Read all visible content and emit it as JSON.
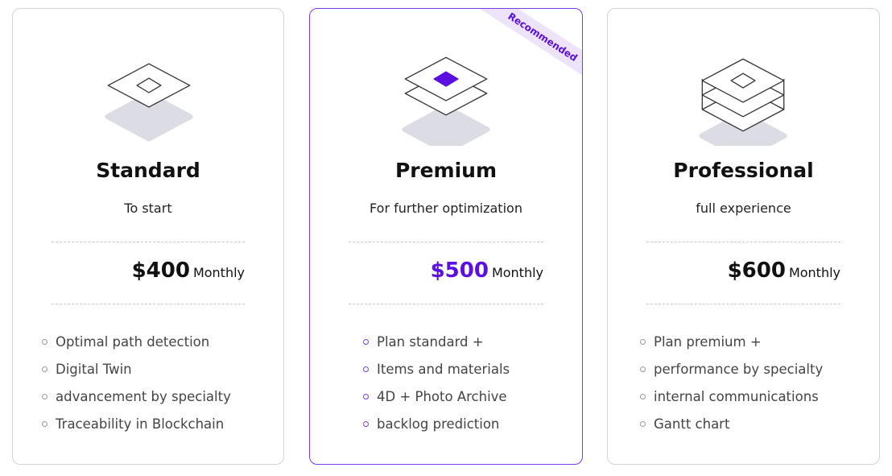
{
  "accent_color": "#5b0fe0",
  "plans": [
    {
      "name": "Standard",
      "subtitle": "To start",
      "price": "$400",
      "period": "Monthly",
      "features": [
        "Optimal path detection",
        "Digital Twin",
        "advancement by specialty",
        "Traceability in Blockchain"
      ],
      "icon": "single-layer-icon"
    },
    {
      "name": "Premium",
      "subtitle": "For further optimization",
      "price": "$500",
      "period": "Monthly",
      "badge": "Recommended",
      "features": [
        "Plan standard +",
        "Items and materials",
        "4D + Photo Archive",
        "backlog prediction"
      ],
      "icon": "double-layer-icon"
    },
    {
      "name": "Professional",
      "subtitle": "full experience",
      "price": "$600",
      "period": "Monthly",
      "features": [
        "Plan premium +",
        "performance by specialty",
        "internal communications",
        "Gantt chart"
      ],
      "icon": "triple-layer-icon"
    }
  ]
}
